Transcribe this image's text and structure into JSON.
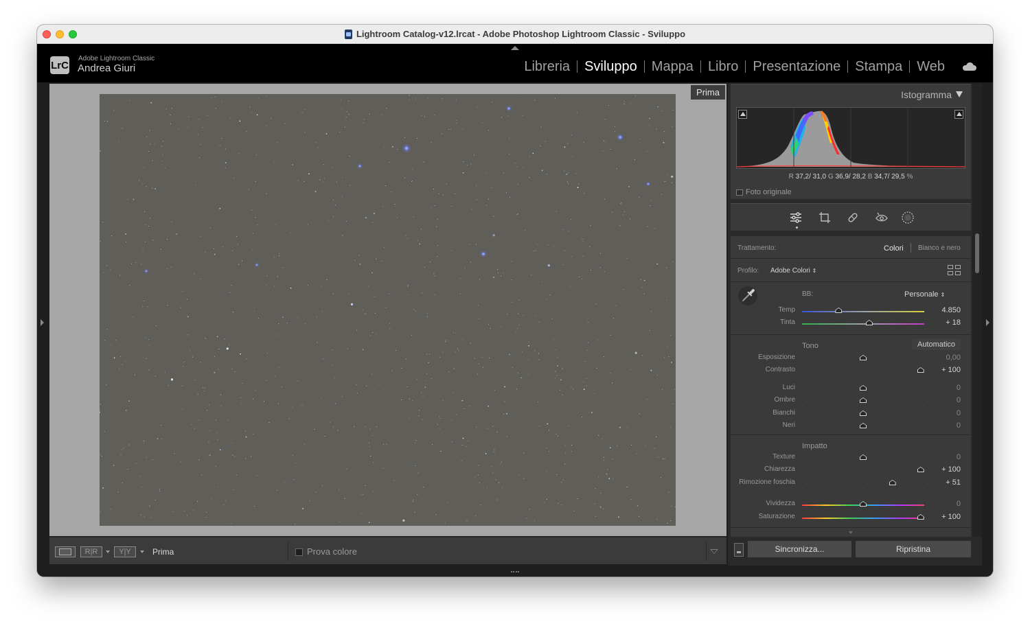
{
  "window": {
    "title": "Lightroom Catalog-v12.lrcat - Adobe Photoshop Lightroom Classic - Sviluppo"
  },
  "header": {
    "badge": "LrC",
    "app_name": "Adobe Lightroom Classic",
    "user": "Andrea Giuri",
    "modules": [
      "Libreria",
      "Sviluppo",
      "Mappa",
      "Libro",
      "Presentazione",
      "Stampa",
      "Web"
    ],
    "active_module": "Sviluppo",
    "cloud_icon": "cloud-icon"
  },
  "viewer": {
    "badge": "Prima"
  },
  "toolbar": {
    "mode_label": "Prima",
    "before_after_1": "R|R",
    "before_after_2": "Y|Y",
    "proof_label": "Prova colore"
  },
  "histogram": {
    "title": "Istogramma",
    "readout": {
      "r_label": "R",
      "r_value": "37,2/ 31,0",
      "g_label": "G",
      "g_value": "36,9/ 28,2",
      "b_label": "B",
      "b_value": "34,7/ 29,5",
      "unit": "%"
    },
    "original_photo_label": "Foto originale"
  },
  "tools": [
    "sliders-icon",
    "crop-icon",
    "healing-icon",
    "red-eye-icon",
    "mask-icon"
  ],
  "basic": {
    "treatment_label": "Trattamento:",
    "treatment_color": "Colori",
    "treatment_bw": "Bianco e nero",
    "profile_label": "Profilo:",
    "profile_value": "Adobe Colori",
    "wb_label": "BB:",
    "wb_value": "Personale",
    "tone_label": "Tono",
    "auto_label": "Automatico",
    "presence_label": "Impatto",
    "sliders": {
      "temp": {
        "label": "Temp",
        "value": "4.850",
        "pos": 0.3
      },
      "tint": {
        "label": "Tinta",
        "value": "+ 18",
        "pos": 0.55
      },
      "exposure": {
        "label": "Esposizione",
        "value": "0,00",
        "pos": 0.5
      },
      "contrast": {
        "label": "Contrasto",
        "value": "+ 100",
        "pos": 0.97
      },
      "highlights": {
        "label": "Luci",
        "value": "0",
        "pos": 0.5
      },
      "shadows": {
        "label": "Ombre",
        "value": "0",
        "pos": 0.5
      },
      "whites": {
        "label": "Bianchi",
        "value": "0",
        "pos": 0.5
      },
      "blacks": {
        "label": "Neri",
        "value": "0",
        "pos": 0.5
      },
      "texture": {
        "label": "Texture",
        "value": "0",
        "pos": 0.5
      },
      "clarity": {
        "label": "Chiarezza",
        "value": "+ 100",
        "pos": 0.97
      },
      "dehaze": {
        "label": "Rimozione foschia",
        "value": "+ 51",
        "pos": 0.74
      },
      "vibrance": {
        "label": "Vividezza",
        "value": "0",
        "pos": 0.5
      },
      "saturation": {
        "label": "Saturazione",
        "value": "+ 100",
        "pos": 0.97
      }
    }
  },
  "panel_footer": {
    "sync_label": "Sincronizza...",
    "reset_label": "Ripristina"
  },
  "colors": {
    "accent_blue": "#8fa8ff",
    "panel_bg": "#3a3a3a",
    "viewer_bg": "#a6a6a6"
  }
}
